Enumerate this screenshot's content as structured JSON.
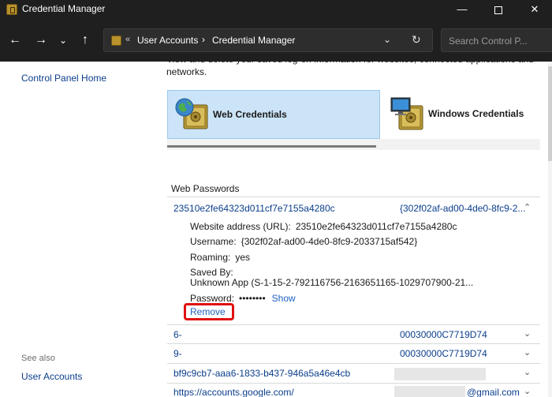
{
  "window": {
    "title": "Credential Manager",
    "min_glyph": "—",
    "close_glyph": "✕"
  },
  "nav": {
    "back_glyph": "←",
    "forward_glyph": "→",
    "recent_glyph": "⌄",
    "up_glyph": "↑",
    "breadcrumb_sep0": "«",
    "breadcrumb": [
      "User Accounts",
      "Credential Manager"
    ],
    "breadcrumb_sep": "›",
    "dropdown_glyph": "⌄",
    "refresh_glyph": "↻",
    "search_placeholder": "Search Control P..."
  },
  "left_pane": {
    "home_link": "Control Panel Home",
    "see_also_label": "See also",
    "see_also_links": [
      "User Accounts"
    ]
  },
  "main": {
    "intro_text": "View and delete your saved log-on information for websites, connected applications and networks.",
    "tabs": [
      {
        "label": "Web Credentials",
        "selected": true,
        "icon": "vault-globe-icon"
      },
      {
        "label": "Windows Credentials",
        "selected": false,
        "icon": "vault-monitor-icon"
      }
    ],
    "section_title": "Web Passwords",
    "expanded_entry": {
      "name": "23510e2fe64323d011cf7e7155a4280c",
      "user_preview": "{302f02af-ad00-4de0-8fc9-2...",
      "chevron": "⌃",
      "details": {
        "website_label": "Website address (URL):",
        "website_value": "23510e2fe64323d011cf7e7155a4280c",
        "username_label": "Username:",
        "username_value": "{302f02af-ad00-4de0-8fc9-2033715af542}",
        "roaming_label": "Roaming:",
        "roaming_value": "yes",
        "saved_by_label": "Saved By:",
        "saved_by_value": "Unknown App (S-1-15-2-792116756-2163651165-1029707900-21...",
        "password_label": "Password:",
        "password_value": "••••••••",
        "show_label": "Show",
        "remove_label": "Remove"
      }
    },
    "entries": [
      {
        "name": "6-",
        "value": "00030000C7719D74",
        "chevron": "⌄"
      },
      {
        "name": "9-",
        "value": "00030000C7719D74",
        "chevron": "⌄"
      },
      {
        "name": "bf9c9cb7-aaa6-1833-b437-946a5a46e4cb",
        "value": "",
        "chevron": "⌄"
      },
      {
        "name": "https://accounts.google.com/",
        "value": "@gmail.com",
        "chevron": "⌄"
      }
    ]
  },
  "colors": {
    "titlebar": "#1f1f1f",
    "link": "#0b3e8c",
    "selected_tab": "#cce4f7",
    "highlight_box": "#e01010"
  }
}
